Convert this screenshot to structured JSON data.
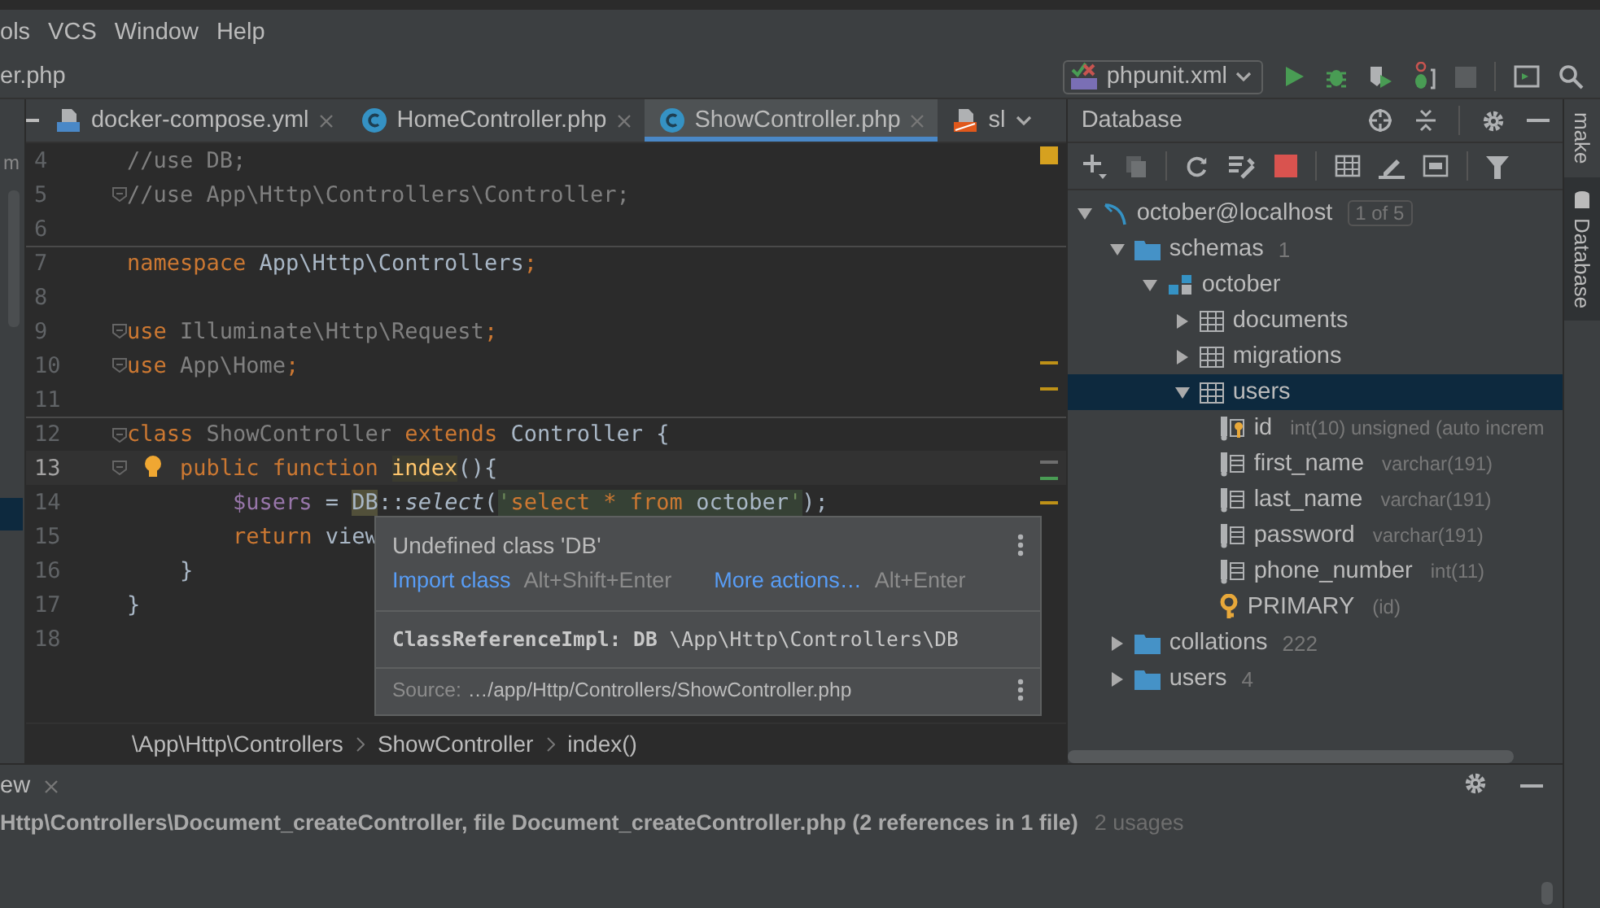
{
  "menu": [
    {
      "label": "ols"
    },
    {
      "label": "VCS"
    },
    {
      "label": "Window"
    },
    {
      "label": "Help"
    }
  ],
  "navbar": {
    "file": "er.php",
    "run_config": "phpunit.xml"
  },
  "project_pane": {
    "text": "m"
  },
  "tabs": [
    {
      "label": "docker-compose.yml",
      "kind": "compose",
      "selected": false,
      "closable": true
    },
    {
      "label": "HomeController.php",
      "kind": "class",
      "selected": false,
      "closable": true
    },
    {
      "label": "ShowController.php",
      "kind": "class",
      "selected": true,
      "closable": true
    },
    {
      "label": "sl",
      "kind": "layout",
      "selected": false,
      "closable": false
    }
  ],
  "editor": {
    "lines": [
      {
        "number": "4",
        "current": false,
        "fold": false,
        "separator_above": false,
        "tokens": [
          {
            "kind": "comment",
            "text": "//use DB;"
          }
        ]
      },
      {
        "number": "5",
        "current": false,
        "fold": true,
        "separator_above": false,
        "tokens": [
          {
            "kind": "comment",
            "text": "//use App\\Http\\Controllers\\Controller;"
          }
        ]
      },
      {
        "number": "6",
        "current": false,
        "fold": false,
        "separator_above": false
      },
      {
        "number": "7",
        "current": false,
        "fold": false,
        "separator_above": true,
        "tokens": [
          {
            "kind": "kw",
            "text": "namespace"
          },
          {
            "kind": "plain",
            "text": " App\\Http\\Controllers"
          },
          {
            "kind": "kw",
            "text": ";"
          }
        ]
      },
      {
        "number": "8",
        "current": false,
        "fold": false,
        "separator_above": false
      },
      {
        "number": "9",
        "current": false,
        "fold": true,
        "separator_above": false,
        "tokens": [
          {
            "kind": "kw",
            "text": "use"
          },
          {
            "kind": "unused",
            "text": " Illuminate\\Http\\Request"
          },
          {
            "kind": "kw",
            "text": ";"
          }
        ]
      },
      {
        "number": "10",
        "current": false,
        "fold": true,
        "separator_above": false,
        "tokens": [
          {
            "kind": "kw",
            "text": "use"
          },
          {
            "kind": "unused",
            "text": " App\\Home"
          },
          {
            "kind": "kw",
            "text": ";"
          }
        ]
      },
      {
        "number": "11",
        "current": false,
        "fold": false,
        "separator_above": false
      },
      {
        "number": "12",
        "current": false,
        "fold": true,
        "separator_above": true,
        "tokens": [
          {
            "kind": "kw",
            "text": "class"
          },
          {
            "kind": "unused",
            "text": " ShowController "
          },
          {
            "kind": "kw",
            "text": "extends"
          },
          {
            "kind": "plain",
            "text": " Controller {"
          }
        ]
      },
      {
        "number": "13",
        "current": true,
        "fold": true,
        "separator_above": false,
        "bulb": true,
        "tokens": [
          {
            "kind": "kw",
            "text": "    public function "
          },
          {
            "kind": "fn",
            "text": "index"
          },
          {
            "kind": "plain",
            "text": "(){"
          }
        ]
      },
      {
        "number": "14",
        "current": false,
        "fold": false,
        "separator_above": false,
        "tokens": [
          {
            "kind": "var",
            "text": "        $users"
          },
          {
            "kind": "plain",
            "text": " = "
          },
          {
            "kind": "warn",
            "text": "DB"
          },
          {
            "kind": "plain",
            "text": "::"
          },
          {
            "kind": "method",
            "text": "select"
          },
          {
            "kind": "plain",
            "text": "("
          },
          {
            "kind": "string",
            "text": "'"
          },
          {
            "kind": "sqlkw",
            "text": "select * from "
          },
          {
            "kind": "sqlid",
            "text": "october"
          },
          {
            "kind": "string",
            "text": "'"
          },
          {
            "kind": "plain",
            "text": ");"
          }
        ]
      },
      {
        "number": "15",
        "current": false,
        "fold": false,
        "separator_above": false,
        "tokens": [
          {
            "kind": "kw",
            "text": "        return"
          },
          {
            "kind": "plain",
            "text": " view"
          }
        ]
      },
      {
        "number": "16",
        "current": false,
        "fold": false,
        "separator_above": false,
        "tokens": [
          {
            "kind": "plain",
            "text": "    }"
          }
        ]
      },
      {
        "number": "17",
        "current": false,
        "fold": false,
        "separator_above": false,
        "tokens": [
          {
            "kind": "plain",
            "text": "}"
          }
        ]
      },
      {
        "number": "18",
        "current": false,
        "fold": false,
        "separator_above": false
      }
    ]
  },
  "popup": {
    "title": "Undefined class 'DB'",
    "actions": [
      {
        "label": "Import class",
        "shortcut": "Alt+Shift+Enter"
      },
      {
        "label": "More actions…",
        "shortcut": "Alt+Enter"
      }
    ],
    "reference": "**ClassReferenceImpl: DB** \\App\\Http\\Controllers\\DB",
    "source_label": "Source:",
    "source_path": "…/app/Http/Controllers/ShowController.php"
  },
  "breadcrumbs": [
    {
      "label": "\\App\\Http\\Controllers"
    },
    {
      "label": "ShowController"
    },
    {
      "label": "index()"
    }
  ],
  "database": {
    "title": "Database",
    "tree": [
      {
        "label": "october@localhost",
        "kind": "datasource",
        "badge": "1 of 5",
        "expanded": true,
        "selected": false,
        "children": [
          {
            "label": "schemas",
            "kind": "folder",
            "count": "1",
            "expanded": true,
            "selected": false,
            "children": [
              {
                "label": "october",
                "kind": "schema",
                "expanded": true,
                "selected": false,
                "children": [
                  {
                    "label": "documents",
                    "kind": "table",
                    "expanded": false,
                    "selected": false
                  },
                  {
                    "label": "migrations",
                    "kind": "table",
                    "expanded": false,
                    "selected": false
                  },
                  {
                    "label": "users",
                    "kind": "table",
                    "expanded": true,
                    "selected": true,
                    "children": [
                      {
                        "label": "id",
                        "kind": "key_column",
                        "detail": "int(10) unsigned (auto increm",
                        "selected": false
                      },
                      {
                        "label": "first_name",
                        "kind": "column",
                        "detail": "varchar(191)",
                        "selected": false
                      },
                      {
                        "label": "last_name",
                        "kind": "column",
                        "detail": "varchar(191)",
                        "selected": false
                      },
                      {
                        "label": "password",
                        "kind": "column",
                        "detail": "varchar(191)",
                        "selected": false
                      },
                      {
                        "label": "phone_number",
                        "kind": "column",
                        "detail": "int(11)",
                        "selected": false
                      },
                      {
                        "label": "PRIMARY",
                        "kind": "key",
                        "detail": "(id)",
                        "selected": false
                      }
                    ]
                  }
                ]
              }
            ]
          },
          {
            "label": "collations",
            "kind": "folder",
            "count": "222",
            "expanded": false,
            "selected": false
          },
          {
            "label": "users",
            "kind": "folder",
            "count": "4",
            "expanded": false,
            "selected": false
          }
        ]
      }
    ]
  },
  "side_tabs": [
    {
      "label": "make",
      "selected": false
    },
    {
      "label": "Database",
      "selected": true
    }
  ],
  "bottom_panel": {
    "tab": "ew",
    "text": "Http\\Controllers\\Document_createController, file Document_createController.php (2 references in 1 file)",
    "usages": "2 usages"
  }
}
